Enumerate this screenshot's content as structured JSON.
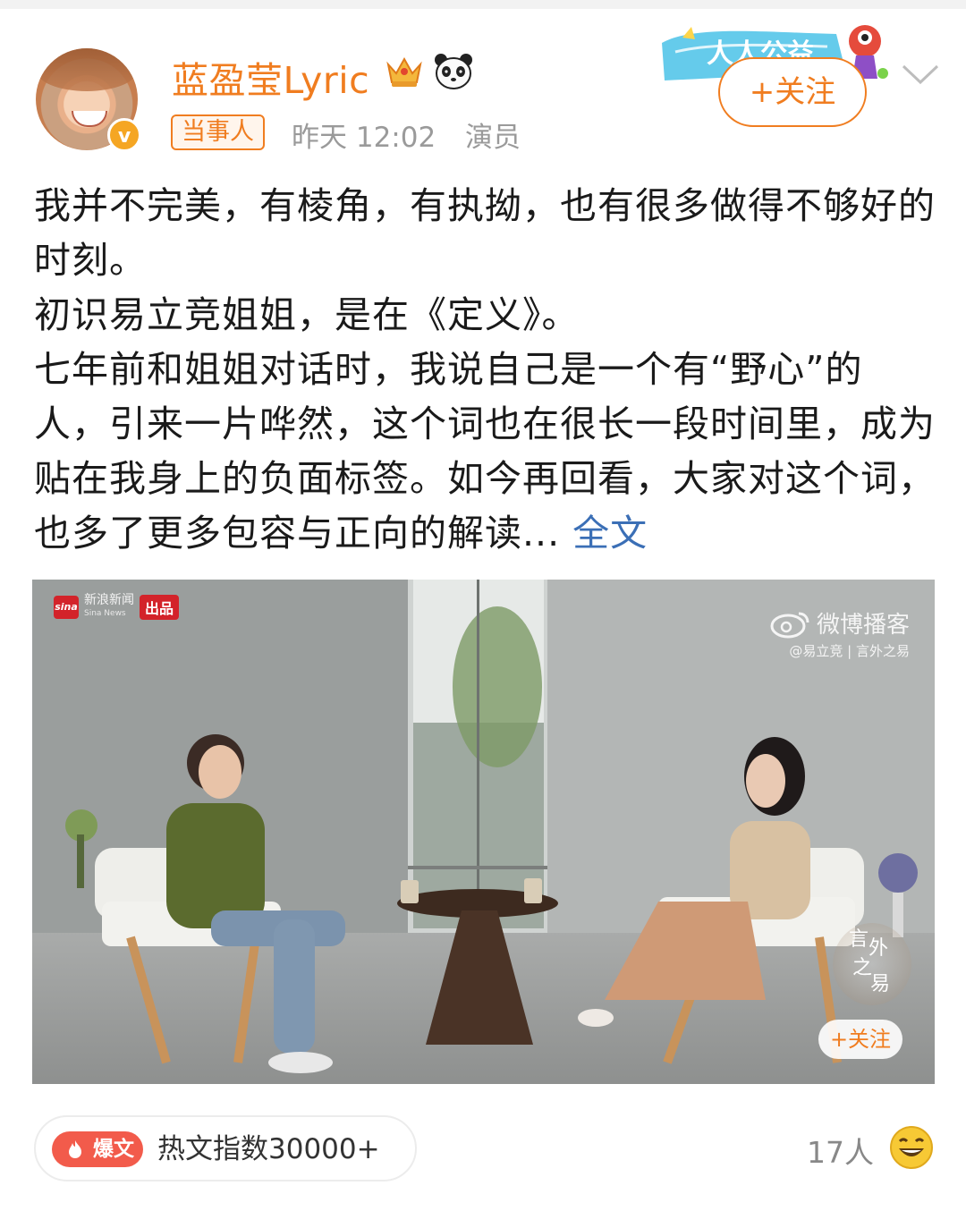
{
  "header": {
    "username": "蓝盈莹Lyric",
    "verified_badge": "v",
    "tag": "当事人",
    "time": "昨天 12:02",
    "role": "演员",
    "follow_label": "+关注",
    "banner_text": "人人公益"
  },
  "post": {
    "paragraphs": [
      "我并不完美，有棱角，有执拗，也有很多做得不够好的时刻。",
      "初识易立竞姐姐，是在《定义》。",
      "七年前和姐姐对话时，我说自己是一个有“野心”的人，引来一片哗然，这个词也在很长一段时间里，成为贴在我身上的负面标签。如今再回看，大家对这个词，也多了更多包容与正向的解读..."
    ],
    "more_label": "全文"
  },
  "video": {
    "source_name": "新浪新闻",
    "source_sub": "Sina News",
    "source_logo_text": "sina",
    "source_tag": "出品",
    "cast_brand": "微博播客",
    "cast_sub": "@易立竞 | 言外之易",
    "show_logo": [
      "言",
      "外",
      "之",
      "易"
    ],
    "follow_label": "+关注"
  },
  "footer": {
    "hot_badge": "爆文",
    "hot_text": "热文指数30000+",
    "likes": "17人"
  },
  "colors": {
    "accent": "#f07d20",
    "link": "#3b6fb6",
    "hot_red": "#f25b4b"
  }
}
